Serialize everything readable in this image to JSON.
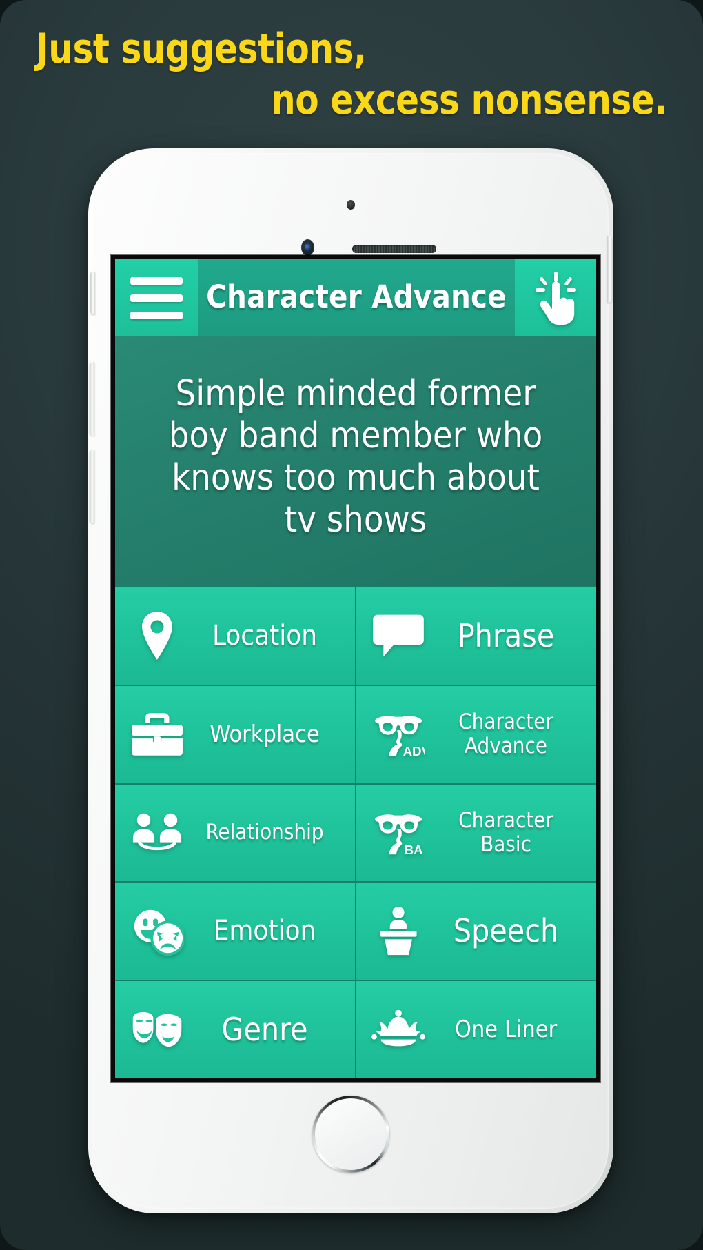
{
  "promo": {
    "headline_line1": "Just suggestions,",
    "headline_line2": "no excess nonsense.",
    "headline_color": "#FAD717",
    "background_color": "#2a3b3d"
  },
  "device": {
    "type": "white-smartphone",
    "hardware": {
      "front_camera": "front-camera",
      "proximity_sensor": "proximity-sensor",
      "earpiece_speaker": "earpiece-speaker",
      "home_button": "home-button",
      "silent_switch": "silent-switch",
      "volume_up": "volume-up-button",
      "volume_down": "volume-down-button",
      "power_button": "power-button"
    }
  },
  "app": {
    "accent_color": "#1FC89F",
    "header_color": "#21A98D",
    "display_color": "#25806D",
    "appbar": {
      "menu_icon": "hamburger-menu-icon",
      "title": "Character Advance",
      "action_icon": "tap-hand-icon"
    },
    "display": {
      "text": "Simple minded former boy band member who knows too much about tv shows"
    },
    "buttons": [
      {
        "label": "Location",
        "icon": "map-pin-icon",
        "size": "lg"
      },
      {
        "label": "Phrase",
        "icon": "speech-bubble-icon",
        "size": "xl"
      },
      {
        "label": "Workplace",
        "icon": "briefcase-icon",
        "size": "md"
      },
      {
        "label": "Character Advance",
        "icon": "disguise-glasses-adv-icon",
        "size": "two",
        "tag": "ADV"
      },
      {
        "label": "Relationship",
        "icon": "two-people-icon",
        "size": "sm"
      },
      {
        "label": "Character Basic",
        "icon": "disguise-glasses-ba-icon",
        "size": "two",
        "tag": "BA"
      },
      {
        "label": "Emotion",
        "icon": "emotion-faces-icon",
        "size": "lg"
      },
      {
        "label": "Speech",
        "icon": "podium-icon",
        "size": "xl"
      },
      {
        "label": "Genre",
        "icon": "theater-masks-icon",
        "size": "xl"
      },
      {
        "label": "One Liner",
        "icon": "jester-hat-icon",
        "size": "md"
      }
    ]
  }
}
